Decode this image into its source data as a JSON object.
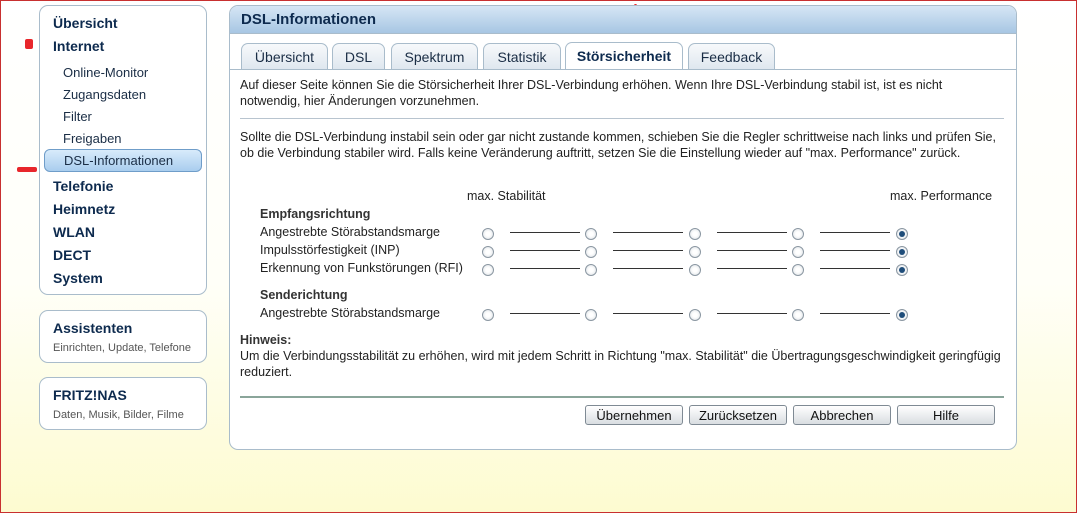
{
  "nav": {
    "items": [
      {
        "label": "Übersicht"
      },
      {
        "label": "Internet"
      },
      {
        "label": "Telefonie"
      },
      {
        "label": "Heimnetz"
      },
      {
        "label": "WLAN"
      },
      {
        "label": "DECT"
      },
      {
        "label": "System"
      }
    ],
    "internet_sub": [
      {
        "label": "Online-Monitor"
      },
      {
        "label": "Zugangsdaten"
      },
      {
        "label": "Filter"
      },
      {
        "label": "Freigaben"
      },
      {
        "label": "DSL-Informationen",
        "active": true
      }
    ]
  },
  "assistants": {
    "title": "Assistenten",
    "subtitle": "Einrichten, Update, Telefone"
  },
  "nas": {
    "title": "FRITZ!NAS",
    "subtitle": "Daten, Musik, Bilder, Filme"
  },
  "panel": {
    "title": "DSL-Informationen",
    "tabs": [
      {
        "label": "Übersicht"
      },
      {
        "label": "DSL"
      },
      {
        "label": "Spektrum"
      },
      {
        "label": "Statistik"
      },
      {
        "label": "Störsicherheit",
        "active": true
      },
      {
        "label": "Feedback"
      }
    ],
    "intro": "Auf dieser Seite können Sie die Störsicherheit Ihrer DSL-Verbindung erhöhen. Wenn Ihre DSL-Verbindung stabil ist, ist es nicht notwendig, hier Änderungen vorzunehmen.",
    "instructions": "Sollte die DSL-Verbindung instabil sein oder gar nicht zustande kommen, schieben Sie die Regler schrittweise nach links und prüfen Sie, ob die Verbindung stabiler wird. Falls keine Veränderung auftritt, setzen Sie die Einstellung wieder auf \"max. Performance\" zurück.",
    "scale": {
      "left": "max. Stabilität",
      "right": "max. Performance"
    },
    "receive": {
      "title": "Empfangsrichtung",
      "rows": [
        {
          "label": "Angestrebte Störabstandsmarge",
          "selected_step": 5,
          "steps": 5
        },
        {
          "label": "Impulsstörfestigkeit (INP)",
          "selected_step": 5,
          "steps": 5
        },
        {
          "label": "Erkennung von Funkstörungen (RFI)",
          "selected_step": 5,
          "steps": 5
        }
      ]
    },
    "send": {
      "title": "Senderichtung",
      "rows": [
        {
          "label": "Angestrebte Störabstandsmarge",
          "selected_step": 5,
          "steps": 5
        }
      ]
    },
    "hint_title": "Hinweis:",
    "hint_text": "Um die Verbindungsstabilität zu erhöhen, wird mit jedem Schritt in Richtung \"max. Stabilität\" die Übertragungsgeschwindigkeit geringfügig reduziert.",
    "buttons": {
      "apply": "Übernehmen",
      "reset": "Zurücksetzen",
      "cancel": "Abbrechen",
      "help": "Hilfe"
    }
  },
  "colors": {
    "accent": "#a7c6e3",
    "annotation": "#e8262b",
    "title": "#0d2a4e"
  }
}
